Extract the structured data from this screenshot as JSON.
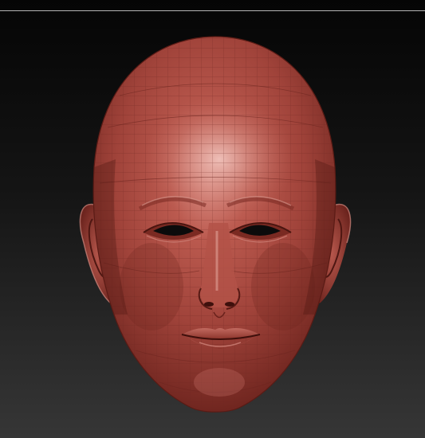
{
  "viewport": {
    "background_top": "#050505",
    "background_bottom": "#363636",
    "border_color": "#b5b5b5"
  },
  "model": {
    "subject": "female-head-sculpt",
    "base_color": "#a8433a",
    "shadow_color": "#5e1d17",
    "highlight_color": "#e0aaa2",
    "wire_color": "#7b2d26",
    "icon": "mesh-icon"
  }
}
